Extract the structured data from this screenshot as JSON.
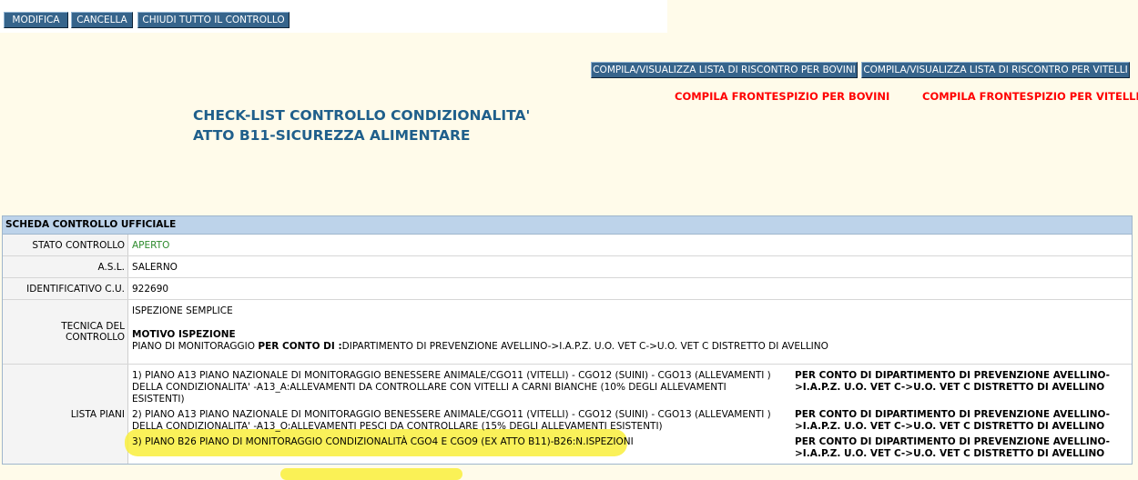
{
  "toolbar": {
    "modifica": "MODIFICA",
    "cancella": "CANCELLA",
    "chiudi": "CHIUDI TUTTO IL CONTROLLO"
  },
  "actions": {
    "lista_bovini": "COMPILA/VISUALIZZA LISTA DI RISCONTRO PER BOVINI",
    "lista_vitelli": "COMPILA/VISUALIZZA LISTA DI RISCONTRO PER VITELLI",
    "frontespizio_bovini": "COMPILA FRONTESPIZIO PER BOVINI",
    "frontespizio_vitelli": "COMPILA FRONTESPIZIO PER VITELLI"
  },
  "title": {
    "line1": "CHECK-LIST CONTROLLO CONDIZIONALITA'",
    "line2": "ATTO B11-SICUREZZA ALIMENTARE"
  },
  "scheda": {
    "header": "SCHEDA CONTROLLO UFFICIALE",
    "stato_label": "STATO CONTROLLO",
    "stato_value": "APERTO",
    "asl_label": "A.S.L.",
    "asl_value": "SALERNO",
    "id_label": "IDENTIFICATIVO C.U.",
    "id_value": "922690",
    "tecnica_label": "TECNICA DEL CONTROLLO",
    "tecnica_value": "ISPEZIONE SEMPLICE",
    "motivo_heading": "MOTIVO ISPEZIONE",
    "motivo_prefix": "PIANO DI MONITORAGGIO ",
    "motivo_bold": "PER CONTO DI :",
    "motivo_text": "DIPARTIMENTO DI PREVENZIONE AVELLINO->I.A.P.Z. U.O. VET C->U.O. VET C DISTRETTO DI AVELLINO",
    "piani_label": "LISTA PIANI",
    "piani": [
      {
        "desc": "1) PIANO A13 PIANO NAZIONALE DI MONITORAGGIO BENESSERE ANIMALE/CGO11 (VITELLI) - CGO12 (SUINI) - CGO13 (ALLEVAMENTI ) DELLA CONDIZIONALITA' -A13_A:ALLEVAMENTI DA CONTROLLARE CON VITELLI A CARNI BIANCHE (10% DEGLI ALLEVAMENTI ESISTENTI)",
        "ente": "PER CONTO DI DIPARTIMENTO DI PREVENZIONE AVELLINO->I.A.P.Z. U.O. VET C->U.O. VET C DISTRETTO DI AVELLINO"
      },
      {
        "desc": "2) PIANO A13 PIANO NAZIONALE DI MONITORAGGIO BENESSERE ANIMALE/CGO11 (VITELLI) - CGO12 (SUINI) - CGO13 (ALLEVAMENTI ) DELLA CONDIZIONALITA' -A13_O:ALLEVAMENTI PESCI DA CONTROLLARE (15% DEGLI ALLEVAMENTI ESISTENTI)",
        "ente": "PER CONTO DI DIPARTIMENTO DI PREVENZIONE AVELLINO->I.A.P.Z. U.O. VET C->U.O. VET C DISTRETTO DI AVELLINO"
      },
      {
        "desc": "3) PIANO B26 PIANO DI MONITORAGGIO CONDIZIONALITÀ CGO4 E CGO9 (EX ATTO B11)-B26:N.ISPEZIONI",
        "ente": "PER CONTO DI DIPARTIMENTO DI PREVENZIONE AVELLINO->I.A.P.Z. U.O. VET C->U.O. VET C DISTRETTO DI AVELLINO"
      }
    ]
  },
  "colors": {
    "button_bg": "#36648b",
    "title": "#1f5f8b",
    "link_red": "#ff0000",
    "status_green": "#2e8b2e",
    "highlight": "#f9ef3c",
    "table_header": "#bdd3ea"
  }
}
